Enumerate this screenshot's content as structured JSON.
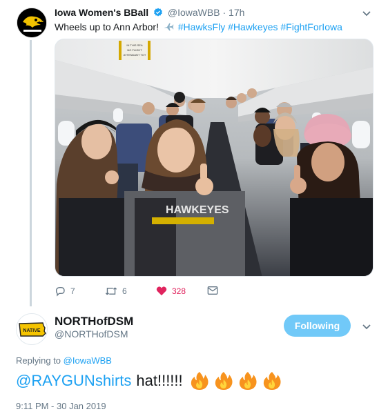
{
  "tweet1": {
    "display_name": "Iowa Women's BBall",
    "handle": "@IowaWBB",
    "separator": "·",
    "time": "17h",
    "text_start": "Wheels up to Ann Arbor!",
    "hashtags": [
      "#HawksFly",
      "#Hawkeyes",
      "#FightForIowa"
    ],
    "photo_sign_text": "IN THIS SEA NO FLIGHT ATTENDANT TOT",
    "photo_sweater_text": "HAWKEYES",
    "actions": {
      "reply_count": "7",
      "retweet_count": "6",
      "like_count": "328"
    },
    "colors": {
      "link": "#1da1f2",
      "like": "#e0245e",
      "muted": "#657786"
    }
  },
  "tweet2": {
    "display_name": "NORTHofDSM",
    "handle": "@NORTHofDSM",
    "avatar_text": "NATIVE",
    "follow_label": "Following",
    "replying_prefix": "Replying to",
    "replying_handle": "@IowaWBB",
    "mention": "@RAYGUNshirts",
    "body": "hat!!!!!!",
    "emoji": [
      "fire-icon",
      "fire-icon",
      "fire-icon",
      "fire-icon"
    ],
    "timestamp": "9:11 PM - 30 Jan 2019",
    "colors": {
      "follow_button": "#71c9f8"
    }
  }
}
